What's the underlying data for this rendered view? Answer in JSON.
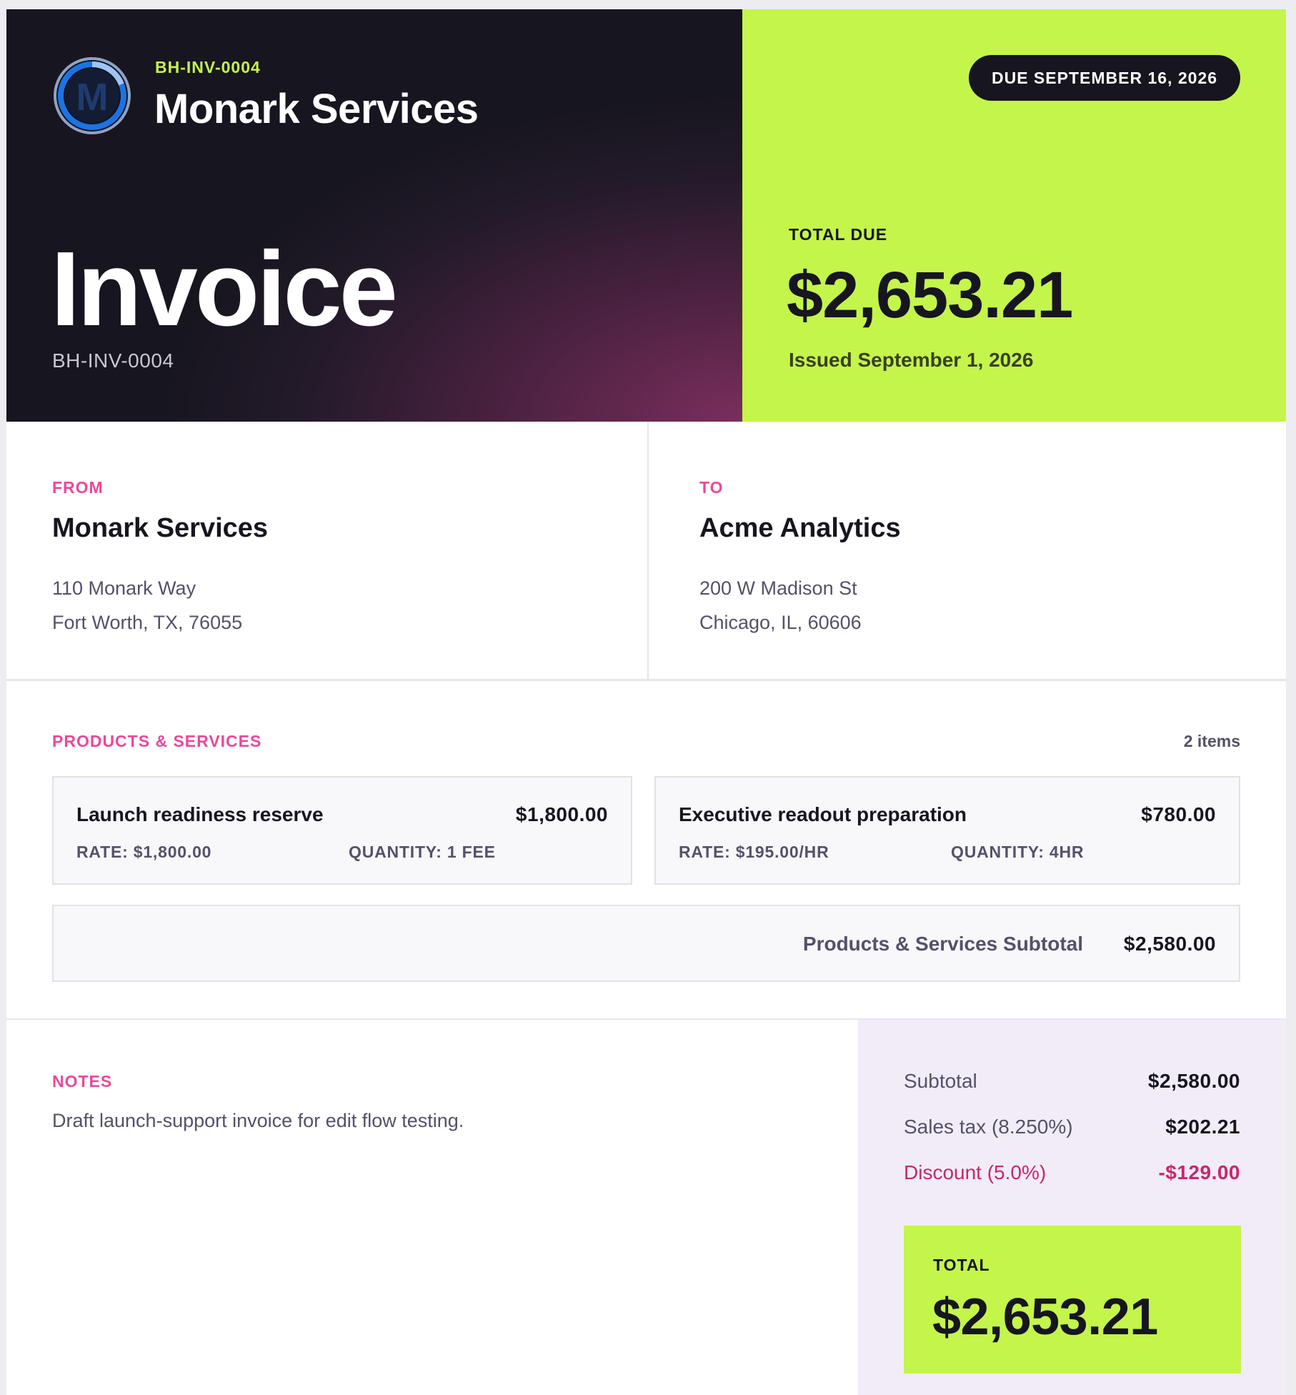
{
  "colors": {
    "accent_lime": "#c4f54b",
    "accent_pink": "#ec4899",
    "discount_red": "#c8266f",
    "dark": "#17151f",
    "logo_blue": "#1b74e4"
  },
  "brand": {
    "code": "BH-INV-0004",
    "name": "Monark Services",
    "logo_icon": "monark-m-logo",
    "logo_letter": "M"
  },
  "hero": {
    "title": "Invoice",
    "invoice_number": "BH-INV-0004",
    "due_label": "DUE SEPTEMBER 16, 2026",
    "total_due_label": "TOTAL DUE",
    "total_due_amount": "$2,653.21",
    "issued": "Issued September 1, 2026"
  },
  "from": {
    "label": "FROM",
    "name": "Monark Services",
    "address_line1": "110 Monark Way",
    "address_line2": "Fort Worth, TX, 76055"
  },
  "to": {
    "label": "TO",
    "name": "Acme Analytics",
    "address_line1": "200 W Madison St",
    "address_line2": "Chicago, IL, 60606"
  },
  "products": {
    "label": "PRODUCTS & SERVICES",
    "count": "2 items",
    "items": [
      {
        "title": "Launch readiness reserve",
        "amount": "$1,800.00",
        "rate": "RATE: $1,800.00",
        "quantity": "QUANTITY: 1 FEE"
      },
      {
        "title": "Executive readout preparation",
        "amount": "$780.00",
        "rate": "RATE: $195.00/HR",
        "quantity": "QUANTITY: 4HR"
      }
    ],
    "subtotal_label": "Products & Services Subtotal",
    "subtotal_value": "$2,580.00"
  },
  "notes": {
    "label": "NOTES",
    "text": "Draft launch-support invoice for edit flow testing."
  },
  "summary": {
    "subtotal_label": "Subtotal",
    "subtotal_value": "$2,580.00",
    "tax_label": "Sales tax (8.250%)",
    "tax_value": "$202.21",
    "discount_label": "Discount (5.0%)",
    "discount_value": "-$129.00",
    "total_label": "TOTAL",
    "total_value": "$2,653.21"
  }
}
